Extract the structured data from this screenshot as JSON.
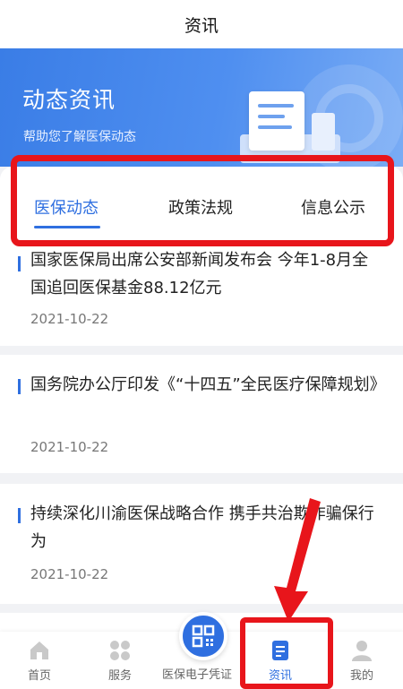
{
  "header": {
    "title": "资讯"
  },
  "banner": {
    "title": "动态资讯",
    "subtitle": "帮助您了解医保动态"
  },
  "tabs": [
    {
      "label": "医保动态",
      "active": true
    },
    {
      "label": "政策法规",
      "active": false
    },
    {
      "label": "信息公示",
      "active": false
    }
  ],
  "articles": [
    {
      "title": "国家医保局出席公安部新闻发布会 今年1-8月全国追回医保基金88.12亿元",
      "date": "2021-10-22"
    },
    {
      "title": "国务院办公厅印发《“十四五”全民医疗保障规划》",
      "date": "2021-10-22"
    },
    {
      "title": "持续深化川渝医保战略合作 携手共治欺诈骗保行为",
      "date": "2021-10-22"
    }
  ],
  "bottom_nav": [
    {
      "label": "首页",
      "icon": "home-icon",
      "active": false
    },
    {
      "label": "服务",
      "icon": "grid-icon",
      "active": false
    },
    {
      "label": "医保电子凭证",
      "icon": "qrcode-icon",
      "active": false
    },
    {
      "label": "资讯",
      "icon": "news-icon",
      "active": true
    },
    {
      "label": "我的",
      "icon": "user-icon",
      "active": false
    }
  ],
  "colors": {
    "accent": "#2f6fe0",
    "annotation": "#e8151b",
    "banner": "#4f8ff0"
  }
}
